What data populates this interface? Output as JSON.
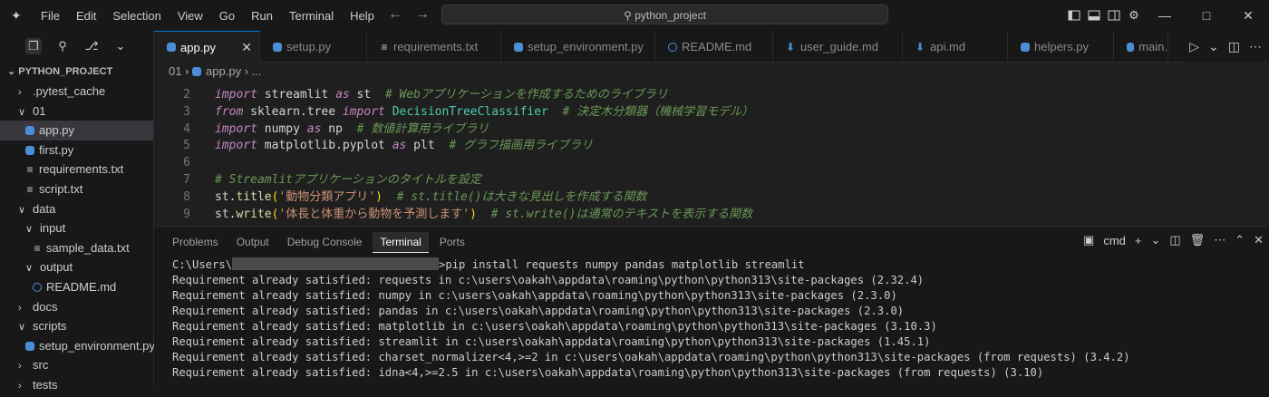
{
  "menu": [
    "File",
    "Edit",
    "Selection",
    "View",
    "Go",
    "Run",
    "Terminal",
    "Help"
  ],
  "search": {
    "text": "python_project"
  },
  "explorer": {
    "title": "PYTHON_PROJECT",
    "items": [
      {
        "label": ".pytest_cache",
        "type": "folder",
        "open": false,
        "indent": 0
      },
      {
        "label": "01",
        "type": "folder",
        "open": true,
        "indent": 0
      },
      {
        "label": "app.py",
        "type": "python",
        "indent": 1,
        "selected": true
      },
      {
        "label": "first.py",
        "type": "python",
        "indent": 1
      },
      {
        "label": "requirements.txt",
        "type": "text",
        "indent": 1
      },
      {
        "label": "script.txt",
        "type": "text",
        "indent": 1
      },
      {
        "label": "data",
        "type": "folder",
        "open": true,
        "indent": 0
      },
      {
        "label": "input",
        "type": "folder",
        "open": true,
        "indent": 1
      },
      {
        "label": "sample_data.txt",
        "type": "text",
        "indent": 2
      },
      {
        "label": "output",
        "type": "folder",
        "open": true,
        "indent": 1
      },
      {
        "label": "README.md",
        "type": "info",
        "indent": 2
      },
      {
        "label": "docs",
        "type": "folder",
        "open": false,
        "indent": 0
      },
      {
        "label": "scripts",
        "type": "folder",
        "open": true,
        "indent": 0
      },
      {
        "label": "setup_environment.py",
        "type": "python",
        "indent": 1
      },
      {
        "label": "src",
        "type": "folder",
        "open": false,
        "indent": 0
      },
      {
        "label": "tests",
        "type": "folder",
        "open": false,
        "indent": 0
      }
    ]
  },
  "tabs": [
    {
      "label": "app.py",
      "type": "python",
      "active": true
    },
    {
      "label": "setup.py",
      "type": "python"
    },
    {
      "label": "requirements.txt",
      "type": "text"
    },
    {
      "label": "setup_environment.py",
      "type": "python"
    },
    {
      "label": "README.md",
      "type": "info"
    },
    {
      "label": "user_guide.md",
      "type": "markdown"
    },
    {
      "label": "api.md",
      "type": "markdown"
    },
    {
      "label": "helpers.py",
      "type": "python"
    },
    {
      "label": "main.",
      "type": "python"
    }
  ],
  "breadcrumb": {
    "folder": "01",
    "file": "app.py",
    "more": "..."
  },
  "editor": {
    "lines": [
      {
        "n": "2",
        "tokens": [
          [
            "kw2",
            "import"
          ],
          [
            "id",
            " streamlit "
          ],
          [
            "kw2",
            "as"
          ],
          [
            "id",
            " st  "
          ],
          [
            "cm",
            "# Webアプリケーションを作成するためのライブラリ"
          ]
        ]
      },
      {
        "n": "3",
        "tokens": [
          [
            "kw2",
            "from"
          ],
          [
            "id",
            " sklearn.tree "
          ],
          [
            "kw2",
            "import"
          ],
          [
            "id",
            " "
          ],
          [
            "cls",
            "DecisionTreeClassifier"
          ],
          [
            "id",
            "  "
          ],
          [
            "cm",
            "# 決定木分類器（機械学習モデル）"
          ]
        ]
      },
      {
        "n": "4",
        "tokens": [
          [
            "kw2",
            "import"
          ],
          [
            "id",
            " numpy "
          ],
          [
            "kw2",
            "as"
          ],
          [
            "id",
            " np  "
          ],
          [
            "cm",
            "# 数値計算用ライブラリ"
          ]
        ]
      },
      {
        "n": "5",
        "tokens": [
          [
            "kw2",
            "import"
          ],
          [
            "id",
            " matplotlib.pyplot "
          ],
          [
            "kw2",
            "as"
          ],
          [
            "id",
            " plt  "
          ],
          [
            "cm",
            "# グラフ描画用ライブラリ"
          ]
        ]
      },
      {
        "n": "6",
        "tokens": []
      },
      {
        "n": "7",
        "tokens": [
          [
            "cm",
            "# Streamlitアプリケーションのタイトルを設定"
          ]
        ]
      },
      {
        "n": "8",
        "tokens": [
          [
            "id",
            "st."
          ],
          [
            "fn",
            "title"
          ],
          [
            "br",
            "("
          ],
          [
            "st",
            "'動物分類アプリ'"
          ],
          [
            "br",
            ")"
          ],
          [
            "id",
            "  "
          ],
          [
            "cm",
            "# st.title()は大きな見出しを作成する関数"
          ]
        ]
      },
      {
        "n": "9",
        "tokens": [
          [
            "id",
            "st."
          ],
          [
            "fn",
            "write"
          ],
          [
            "br",
            "("
          ],
          [
            "st",
            "'体長と体重から動物を予測します'"
          ],
          [
            "br",
            ")"
          ],
          [
            "id",
            "  "
          ],
          [
            "cm",
            "# st.write()は通常のテキストを表示する関数"
          ]
        ]
      }
    ]
  },
  "panel": {
    "tabs": [
      "Problems",
      "Output",
      "Debug Console",
      "Terminal",
      "Ports"
    ],
    "active": "Terminal",
    "shell": "cmd",
    "prompt_prefix": "C:\\Users\\",
    "prompt_cmd": ">pip install requests numpy pandas matplotlib streamlit",
    "output": [
      "Requirement already satisfied: requests in c:\\users\\oakah\\appdata\\roaming\\python\\python313\\site-packages (2.32.4)",
      "Requirement already satisfied: numpy in c:\\users\\oakah\\appdata\\roaming\\python\\python313\\site-packages (2.3.0)",
      "Requirement already satisfied: pandas in c:\\users\\oakah\\appdata\\roaming\\python\\python313\\site-packages (2.3.0)",
      "Requirement already satisfied: matplotlib in c:\\users\\oakah\\appdata\\roaming\\python\\python313\\site-packages (3.10.3)",
      "Requirement already satisfied: streamlit in c:\\users\\oakah\\appdata\\roaming\\python\\python313\\site-packages (1.45.1)",
      "Requirement already satisfied: charset_normalizer<4,>=2 in c:\\users\\oakah\\appdata\\roaming\\python\\python313\\site-packages (from requests) (3.4.2)",
      "Requirement already satisfied: idna<4,>=2.5 in c:\\users\\oakah\\appdata\\roaming\\python\\python313\\site-packages (from requests) (3.10)"
    ]
  },
  "colors": {
    "accent": "#0078d4",
    "python_icon": "#4a8fd6",
    "editor_bg": "#1f1f1f",
    "chrome_bg": "#181818"
  }
}
